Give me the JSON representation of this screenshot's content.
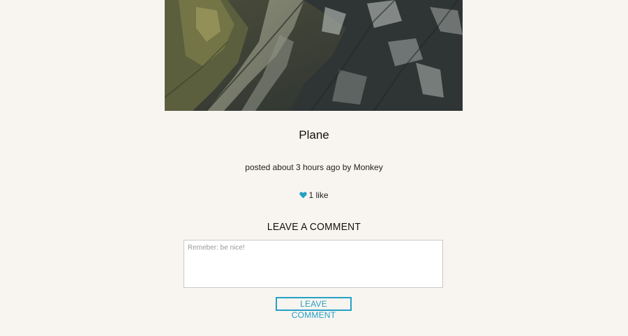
{
  "post": {
    "image_alt": "Mountain valley aerial photo",
    "title": "Plane",
    "meta": "posted about 3 hours ago by Monkey",
    "likes_label": "1 like",
    "heart_icon": "heart-icon",
    "accent_color": "#27a0c6"
  },
  "comment": {
    "heading": "LEAVE A COMMENT",
    "placeholder": "Remeber: be nice!",
    "value": "",
    "submit_label": "LEAVE COMMENT"
  }
}
